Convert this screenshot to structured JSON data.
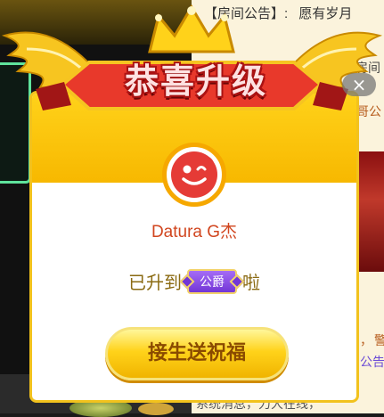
{
  "background": {
    "notice_label": "【房间公告】:",
    "notice_text": "愿有岁月",
    "side_fragments": [
      "登入房间",
      "哥公",
      "，",
      "警",
      "公告",
      "系统消息，力大在线，"
    ]
  },
  "modal": {
    "title": "恭喜升级",
    "close_label": "×",
    "username": "Datura G杰",
    "upgrade_prefix": "已升到",
    "rank": "公爵",
    "upgrade_suffix": "啦",
    "bless_button": "接生送祝福"
  },
  "colors": {
    "accent_gold": "#f2c21d",
    "title_red": "#b11414",
    "rank_purple": "#7236d6",
    "username_color": "#d1461f"
  },
  "icons": {
    "avatar": "smiling-face-avatar-icon",
    "wings": "golden-wings-icon",
    "crown": "crown-icon",
    "close": "close-icon"
  }
}
